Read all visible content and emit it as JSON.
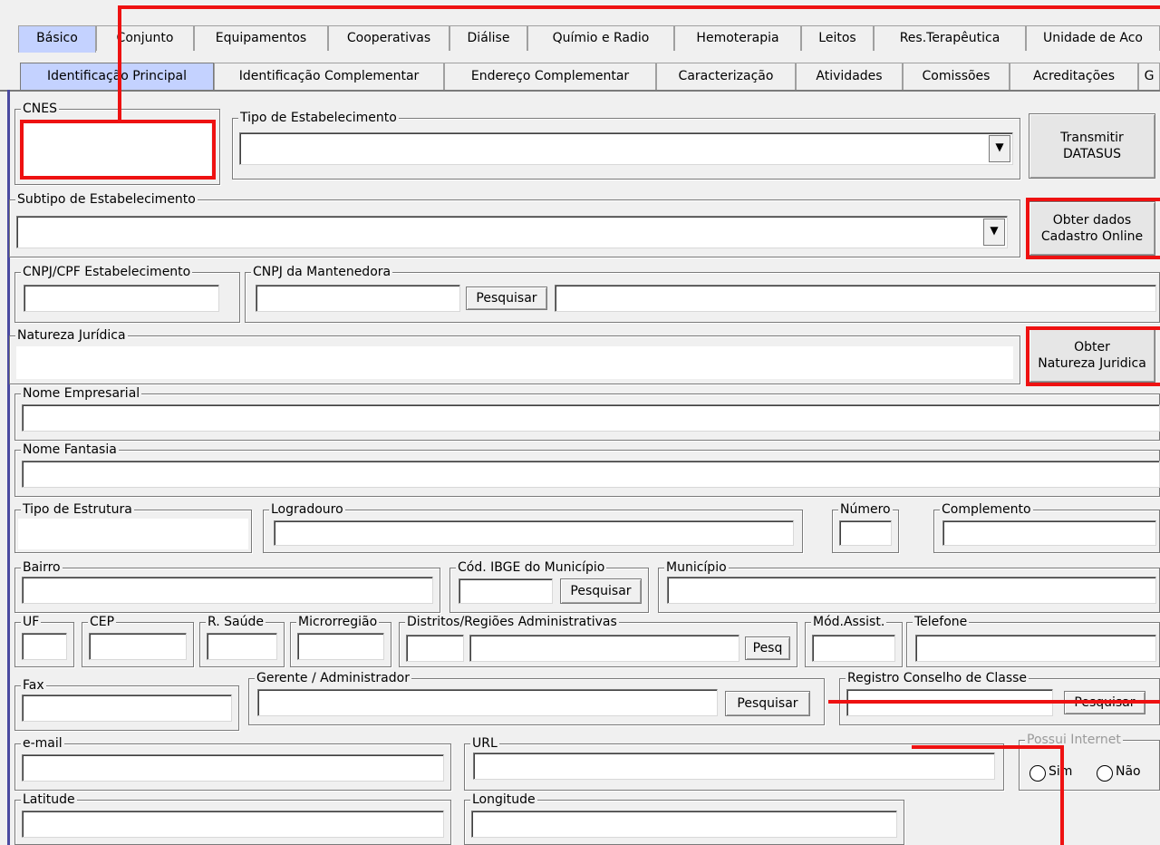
{
  "tabs_main": [
    "Básico",
    "Conjunto",
    "Equipamentos",
    "Cooperativas",
    "Diálise",
    "Químio e Radio",
    "Hemoterapia",
    "Leitos",
    "Res.Terapêutica",
    "Unidade de Aco"
  ],
  "tabs_sub": [
    "Identificação Principal",
    "Identificação Complementar",
    "Endereço Complementar",
    "Caracterização",
    "Atividades",
    "Comissões",
    "Acreditações",
    "G"
  ],
  "labels": {
    "cnes": "CNES",
    "tipo_estab": "Tipo de Estabelecimento",
    "subtipo": "Subtipo de Estabelecimento",
    "cnpj_estab": "CNPJ/CPF Estabelecimento",
    "cnpj_mant": "CNPJ da Mantenedora",
    "natureza": "Natureza Jurídica",
    "nome_emp": "Nome Empresarial",
    "nome_fant": "Nome Fantasia",
    "tipo_estrut": "Tipo de Estrutura",
    "logradouro": "Logradouro",
    "numero": "Número",
    "complemento": "Complemento",
    "bairro": "Bairro",
    "cod_ibge": "Cód. IBGE do Município",
    "municipio": "Município",
    "uf": "UF",
    "cep": "CEP",
    "rsaude": "R. Saúde",
    "microrregiao": "Microrregião",
    "distritos": "Distritos/Regiões Administrativas",
    "mod_assist": "Mód.Assist.",
    "telefone": "Telefone",
    "fax": "Fax",
    "gerente": "Gerente / Administrador",
    "registro": "Registro Conselho de Classe",
    "email": "e-mail",
    "url": "URL",
    "possui_internet": "Possui Internet",
    "latitude": "Latitude",
    "longitude": "Longitude"
  },
  "buttons": {
    "transmitir": "Transmitir\nDATASUS",
    "obter_cadastro": "Obter dados\nCadastro Online",
    "obter_natureza": "Obter\nNatureza Juridica",
    "pesquisar": "Pesquisar",
    "pesq": "Pesq"
  },
  "radio": {
    "sim": "Sim",
    "nao": "Não"
  },
  "icons": {
    "dropdown": "chevron-down-icon"
  },
  "colors": {
    "active_tab": "#c4d2ff",
    "highlight": "#ee1111"
  }
}
